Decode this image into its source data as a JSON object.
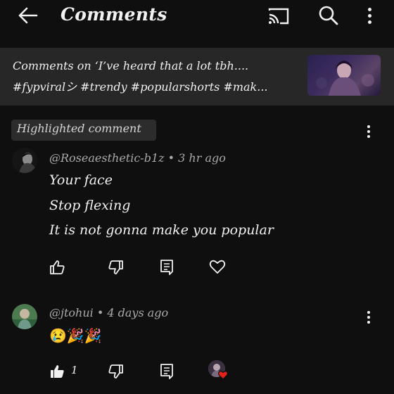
{
  "header": {
    "title": "Comments",
    "back_icon": "arrow-left-icon",
    "cast_icon": "cast-icon",
    "search_icon": "search-icon",
    "menu_icon": "more-vert-icon"
  },
  "video": {
    "line1": "Comments on ‘I’ve heard that a lot tbh....",
    "line2": "#fypviralシ #trendy #popularshorts #mak..."
  },
  "highlighted_label": "Highlighted comment",
  "comments": [
    {
      "author": "@Roseaesthetic-b1z",
      "separator": " • ",
      "time": "3 hr ago",
      "lines": [
        "Your face",
        "Stop flexing",
        "It is not gonna make you popular"
      ],
      "likes": ""
    },
    {
      "author": "@jtohui",
      "separator": " • ",
      "time": "4 days ago",
      "lines": [
        "😢🎉🎉"
      ],
      "likes": "1"
    }
  ],
  "colors": {
    "background": "#0f0f0f",
    "header_card": "#272727",
    "meta_text": "#aaaaaa",
    "heart_red": "#e62117"
  }
}
